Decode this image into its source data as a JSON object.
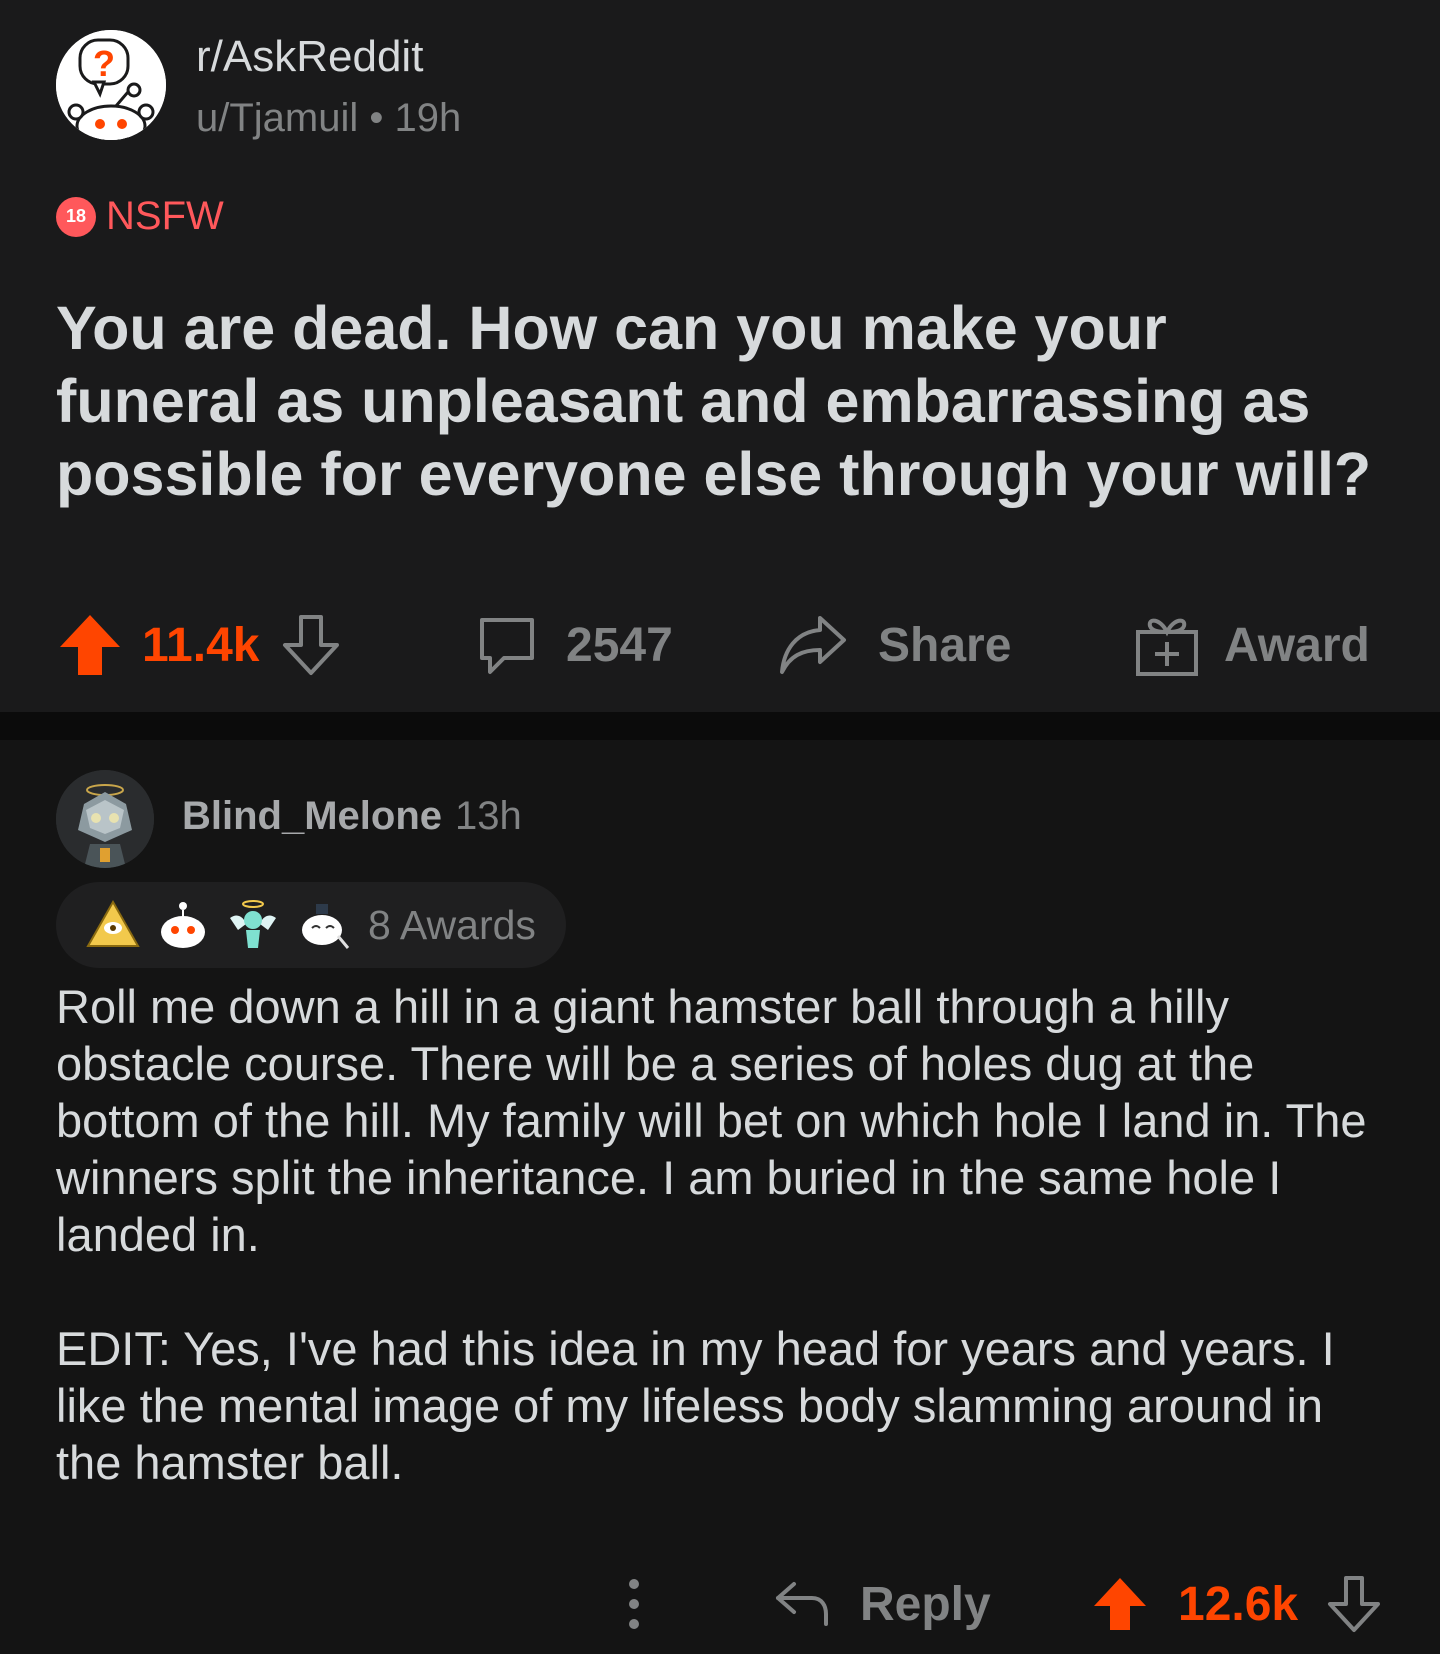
{
  "post": {
    "subreddit": "r/AskReddit",
    "author": "u/Tjamuil",
    "separator": "•",
    "age": "19h",
    "nsfw_badge": "18",
    "nsfw_label": "NSFW",
    "title": "You are dead. How can you make your funeral as unpleasant and embarrassing as possible for everyone else through your will?",
    "actions": {
      "upvotes": "11.4k",
      "comments": "2547",
      "share_label": "Share",
      "award_label": "Award"
    }
  },
  "comment": {
    "author": "Blind_Melone",
    "age": "13h",
    "awards_label": "8 Awards",
    "award_icons": [
      "pyramid-award-icon",
      "snoo-award-icon",
      "angel-award-icon",
      "wholesome-award-icon"
    ],
    "body": [
      "Roll me down a hill in a giant hamster ball through a hilly obstacle course. There will be a series of holes dug at the bottom of the hill. My family will bet on which hole I land in. The winners split the inheritance. I am buried in the same hole I landed in.",
      "EDIT: Yes, I've had this idea in my head for years and years. I like the mental image of my lifeless body slamming around in the hamster ball."
    ],
    "actions": {
      "reply_label": "Reply",
      "upvotes": "12.6k"
    }
  },
  "colors": {
    "background": "#1a1a1b",
    "upvote": "#ff4500",
    "nsfw": "#ff585b",
    "muted": "#818384",
    "text": "#d7dadc"
  }
}
